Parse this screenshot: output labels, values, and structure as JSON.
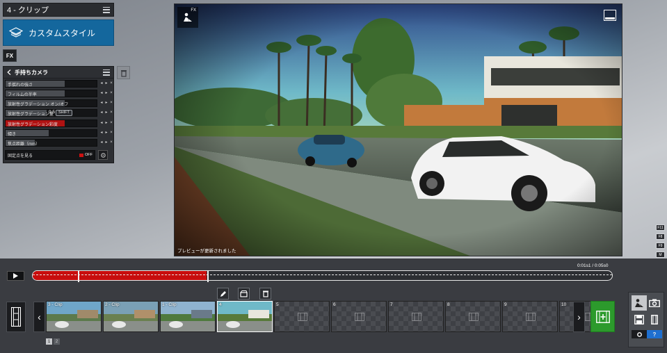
{
  "clip_panel": {
    "title": "4 - クリップ"
  },
  "style_button": {
    "label": "カスタムスタイル"
  },
  "fx_button": {
    "label": "FX"
  },
  "camera_panel": {
    "title": "手持ちカメラ",
    "params": [
      {
        "label": "手揺れの強さ",
        "fill": 0.65,
        "color": "gray"
      },
      {
        "label": "フィルムの半率",
        "fill": 0.65,
        "color": "gray"
      },
      {
        "label": "放射性グラデーション オン/オフ",
        "fill": 0.65,
        "color": "gray"
      },
      {
        "label": "放射性グラデーション量",
        "fill": 0.45,
        "color": "gray",
        "value": "0.5",
        "shift": "SHIFT"
      },
      {
        "label": "放射性グラデーション彩度",
        "fill": 0.65,
        "color": "red"
      },
      {
        "label": "傾き",
        "fill": 0.47,
        "color": "gray"
      },
      {
        "label": "焦点距離（mm）",
        "fill": 0.32,
        "color": "gray"
      }
    ],
    "focus_label": "固定点を見る",
    "focus_toggle": "OFF"
  },
  "preview": {
    "status": "プレビューが更新されました",
    "fx_badge": "FX"
  },
  "fkeys": [
    "F11",
    "F8",
    "F9",
    "M"
  ],
  "timeline": {
    "time": "0:01s1 / 0:05s0",
    "progress": 0.3
  },
  "clips": [
    {
      "label": "3 - Clip",
      "state": "filled"
    },
    {
      "label": "2 - Clip",
      "state": "filled"
    },
    {
      "label": "1 - Clip",
      "state": "filled"
    },
    {
      "label": "4",
      "state": "active"
    },
    {
      "label": "5",
      "state": "empty"
    },
    {
      "label": "6",
      "state": "empty"
    },
    {
      "label": "7",
      "state": "empty"
    },
    {
      "label": "8",
      "state": "empty"
    },
    {
      "label": "9",
      "state": "empty"
    },
    {
      "label": "10",
      "state": "empty"
    }
  ],
  "pages": [
    "1",
    "2"
  ],
  "colors": {
    "accent_blue": "#14679d",
    "record_red": "#c80d0d",
    "add_green": "#2c9a2c"
  },
  "icons": [
    "hamburger-icon",
    "layers-icon",
    "chevron-left-icon",
    "trash-icon",
    "pencil-icon",
    "clapper-icon",
    "film-icon",
    "camera-icon",
    "save-icon",
    "gear-icon",
    "help-icon"
  ],
  "help_label": "?"
}
